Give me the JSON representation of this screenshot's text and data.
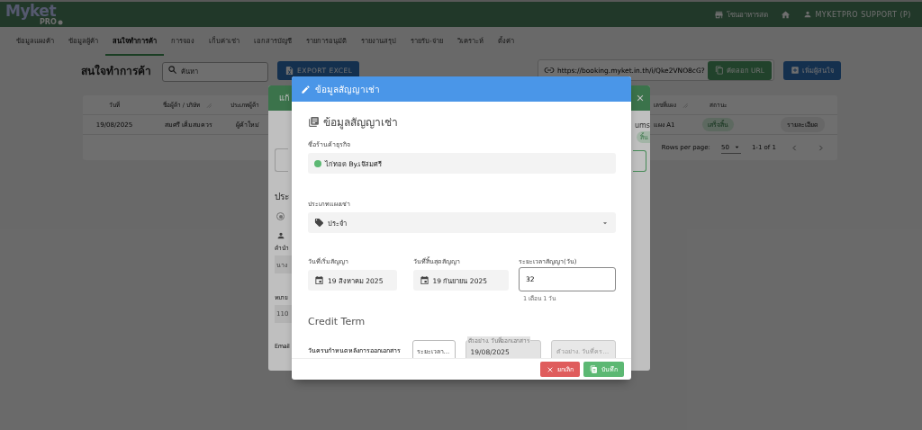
{
  "top_bar": {
    "logo": "Myket",
    "logo_sub": "PRO",
    "market": "โซนอาหารสด",
    "user": "MYKETPRO SUPPORT (P)"
  },
  "nav_tabs": [
    {
      "label": "ข้อมูลแผงค้า",
      "selected": false
    },
    {
      "label": "ข้อมูลผู้ค้า",
      "selected": false
    },
    {
      "label": "สนใจทำการค้า",
      "selected": true
    },
    {
      "label": "การจอง",
      "selected": false
    },
    {
      "label": "เก็บค่าเช่า",
      "selected": false
    },
    {
      "label": "เอกสารบัญชี",
      "selected": false
    },
    {
      "label": "รายการอนุมัติ",
      "selected": false
    },
    {
      "label": "รายงานสรุป",
      "selected": false
    },
    {
      "label": "รายรับ-จ่าย",
      "selected": false
    },
    {
      "label": "วิเคราะห์",
      "selected": false
    },
    {
      "label": "ตั้งค่า",
      "selected": false
    }
  ],
  "toolbar": {
    "title": "สนใจทำการค้า",
    "search": {
      "placeholder": "ค้นหา"
    },
    "export_button": "EXPORT EXCEL",
    "url": "https://booking.myket.in.th/i/Qke2VNO8cG?",
    "copy_button": "คัดลอก URL",
    "add_button": "เพิ่มผู้สนใจ"
  },
  "table": {
    "columns": [
      "วันที่",
      "ชื่อผู้ค้า / บริษัท",
      "ประเภทผู้ค้า",
      "เลขที่แผง",
      "สถานะ"
    ],
    "rows": [
      {
        "date": "19/08/2025",
        "name": "สมศรี เค็มสมควร",
        "type": "ผู้ค้าใหม่",
        "stall": "แผง A1",
        "status": "เสร็จสิ้น",
        "action": "รายละเอียด"
      }
    ],
    "pagination": {
      "rows_per_page_label": "Rows per page:",
      "rows_per_page": "50",
      "range": "1-1 of 1"
    }
  },
  "edit_dialog": {
    "title": "แก้",
    "left_items": [
      {
        "kind": "field"
      },
      {
        "kind": "heading",
        "text": "ประ"
      },
      {
        "kind": "radio",
        "selected": true
      },
      {
        "kind": "person"
      },
      {
        "kind": "label",
        "text": "คำนำ"
      },
      {
        "kind": "value",
        "text": "นาง"
      },
      {
        "kind": "label",
        "text": "หมาย"
      },
      {
        "kind": "value",
        "text": "110"
      },
      {
        "kind": "label",
        "text": "Email"
      }
    ],
    "right_items": [
      {
        "kind": "text",
        "text": "ums"
      },
      {
        "kind": "chip",
        "text": "สิ้น"
      },
      {
        "kind": "field"
      }
    ]
  },
  "contract_dialog": {
    "title": "ข้อมูลสัญญาเช่า",
    "section_title": "ข้อมูลสัญญาเช่า",
    "shop": {
      "label": "ชื่อร้านค้าธุรกิจ",
      "value": "ไก่ทอด By.เจ๊สมศรี",
      "color": "#5cb873"
    },
    "stall_type": {
      "label": "ประเภทแผงเช่า",
      "value": "ประจำ"
    },
    "start_date": {
      "label": "วันที่เริ่มสัญญา",
      "value": "19 สิงหาคม 2025"
    },
    "end_date": {
      "label": "วันที่สิ้นสุดสัญญา",
      "value": "19 กันยายน 2025"
    },
    "duration": {
      "label": "ระยะเวลาสัญญา(วัน)",
      "value": "32",
      "hint": "1 เดือน 1 วัน"
    },
    "credit_title": "Credit Term",
    "credit": {
      "label": "วันครบกำหนดหลังการออกเอกสาร",
      "period": {
        "placeholder": "ระยะเวลา..."
      },
      "issue_date": {
        "label": "ตัวอย่าง. วันที่ออกเอกสาร",
        "value": "19/08/2025",
        "disabled": true
      },
      "due_date": {
        "placeholder": "ตัวอย่าง. วันที่คร...",
        "disabled": true
      }
    },
    "cancel_button": "ยกเลิก",
    "save_button": "บันทึก"
  }
}
